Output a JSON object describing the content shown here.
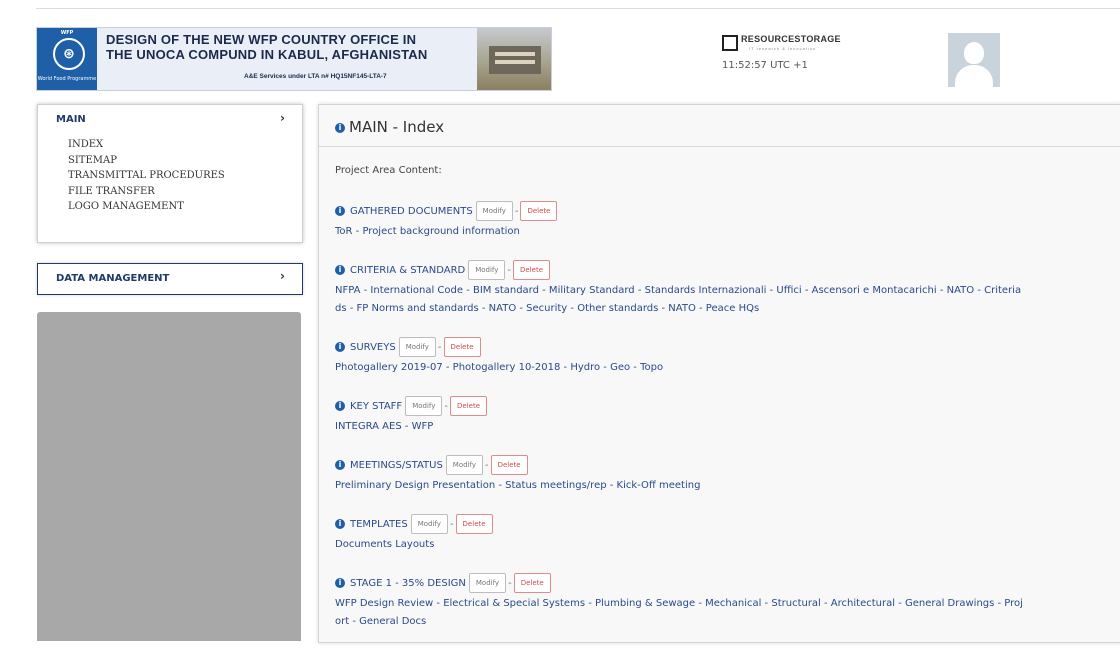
{
  "banner": {
    "logo_top": "WFP",
    "logo_sub": "World Food Programme",
    "title_line1": "DESIGN OF THE NEW WFP COUNTRY OFFICE IN",
    "title_line2": "THE UNOCA COMPUND IN KABUL, AFGHANISTAN",
    "subtitle": "A&E Services under  LTA n# HQ15NF145-LTA-7"
  },
  "header": {
    "brand_prefix": "R",
    "brand": "RESOURCESTORAGE",
    "brand_tagline": "IT research & innovation",
    "clock": "11:52:57 UTC +1"
  },
  "sidebar": {
    "main_label": "MAIN",
    "chevron": "›",
    "items": [
      {
        "label": "INDEX"
      },
      {
        "label": "SITEMAP"
      },
      {
        "label": "TRANSMITTAL PROCEDURES"
      },
      {
        "label": "FILE TRANSFER"
      },
      {
        "label": "LOGO MANAGEMENT"
      }
    ],
    "data_management_label": "DATA MANAGEMENT"
  },
  "main": {
    "info_glyph": "i",
    "title": "MAIN - Index",
    "intro": "Project Area Content:",
    "modify_label": "Modify",
    "delete_label": "Delete",
    "separator": "-",
    "sections": [
      {
        "title": "GATHERED DOCUMENTS",
        "links": "ToR - Project background information"
      },
      {
        "title": "CRITERIA & STANDARD",
        "links": "NFPA - International Code - BIM standard - Military Standard - Standards Internazionali - Uffici - Ascensori e Montacarichi - NATO - Criteria\nds - FP Norms and standards - NATO - Security - Other standards - NATO - Peace HQs"
      },
      {
        "title": "SURVEYS",
        "links": "Photogallery 2019-07 - Photogallery 10-2018 - Hydro - Geo - Topo"
      },
      {
        "title": "KEY STAFF",
        "links": "INTEGRA AES - WFP"
      },
      {
        "title": "MEETINGS/STATUS",
        "links": "Preliminary Design Presentation - Status meetings/rep - Kick-Off meeting"
      },
      {
        "title": "TEMPLATES",
        "links": "Documents Layouts"
      },
      {
        "title": "STAGE 1 - 35% DESIGN",
        "links": "WFP Design Review - Electrical & Special Systems - Plumbing & Sewage - Mechanical - Structural - Architectural - General Drawings - Proj\nort - General Docs"
      }
    ]
  }
}
